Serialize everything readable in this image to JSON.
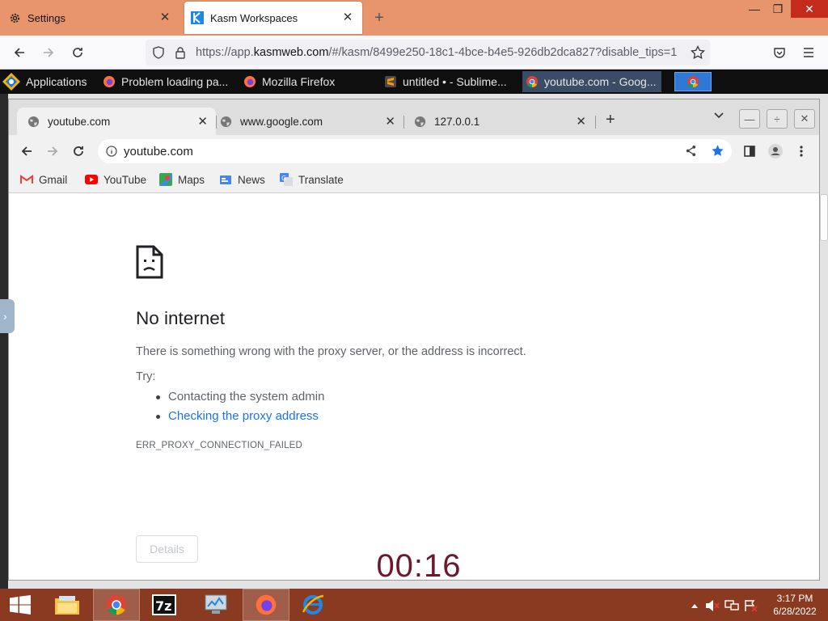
{
  "host_browser": {
    "tabs": [
      {
        "label": "Settings",
        "icon": "gear-icon"
      },
      {
        "label": "Kasm Workspaces",
        "icon": "kasm-logo-icon"
      }
    ],
    "url_prefix": "https://app.",
    "url_domain": "kasmweb.com",
    "url_rest": "/#/kasm/8499e250-18c1-4bce-b4e5-926db2dca827?disable_tips=1"
  },
  "panel": {
    "applications": "Applications",
    "windows": [
      {
        "label": "Problem loading pa...",
        "icon": "firefox-icon"
      },
      {
        "label": "Mozilla Firefox",
        "icon": "firefox-icon"
      },
      {
        "label": "untitled • - Sublime...",
        "icon": "sublime-icon"
      },
      {
        "label": "youtube.com - Goog...",
        "icon": "chrome-icon"
      }
    ]
  },
  "chrome": {
    "tabs": [
      {
        "label": "youtube.com"
      },
      {
        "label": "www.google.com"
      },
      {
        "label": "127.0.0.1"
      }
    ],
    "omnibox": "youtube.com",
    "bookmarks": [
      {
        "label": "Gmail",
        "icon": "gmail-icon"
      },
      {
        "label": "YouTube",
        "icon": "youtube-icon"
      },
      {
        "label": "Maps",
        "icon": "maps-icon"
      },
      {
        "label": "News",
        "icon": "news-icon"
      },
      {
        "label": "Translate",
        "icon": "translate-icon"
      }
    ]
  },
  "error_page": {
    "title": "No internet",
    "message": "There is something wrong with the proxy server, or the address is incorrect.",
    "try_label": "Try:",
    "suggestions": [
      "Contacting the system admin",
      "Checking the proxy address"
    ],
    "error_code": "ERR_PROXY_CONNECTION_FAILED",
    "details_button": "Details"
  },
  "timer": "00:16",
  "taskbar": {
    "time": "3:17 PM",
    "date": "6/28/2022"
  },
  "colors": {
    "host_tab_bar": "#e8956d",
    "taskbar": "#8b3a22",
    "link": "#1a73e8",
    "timer": "#6b1a2e"
  }
}
